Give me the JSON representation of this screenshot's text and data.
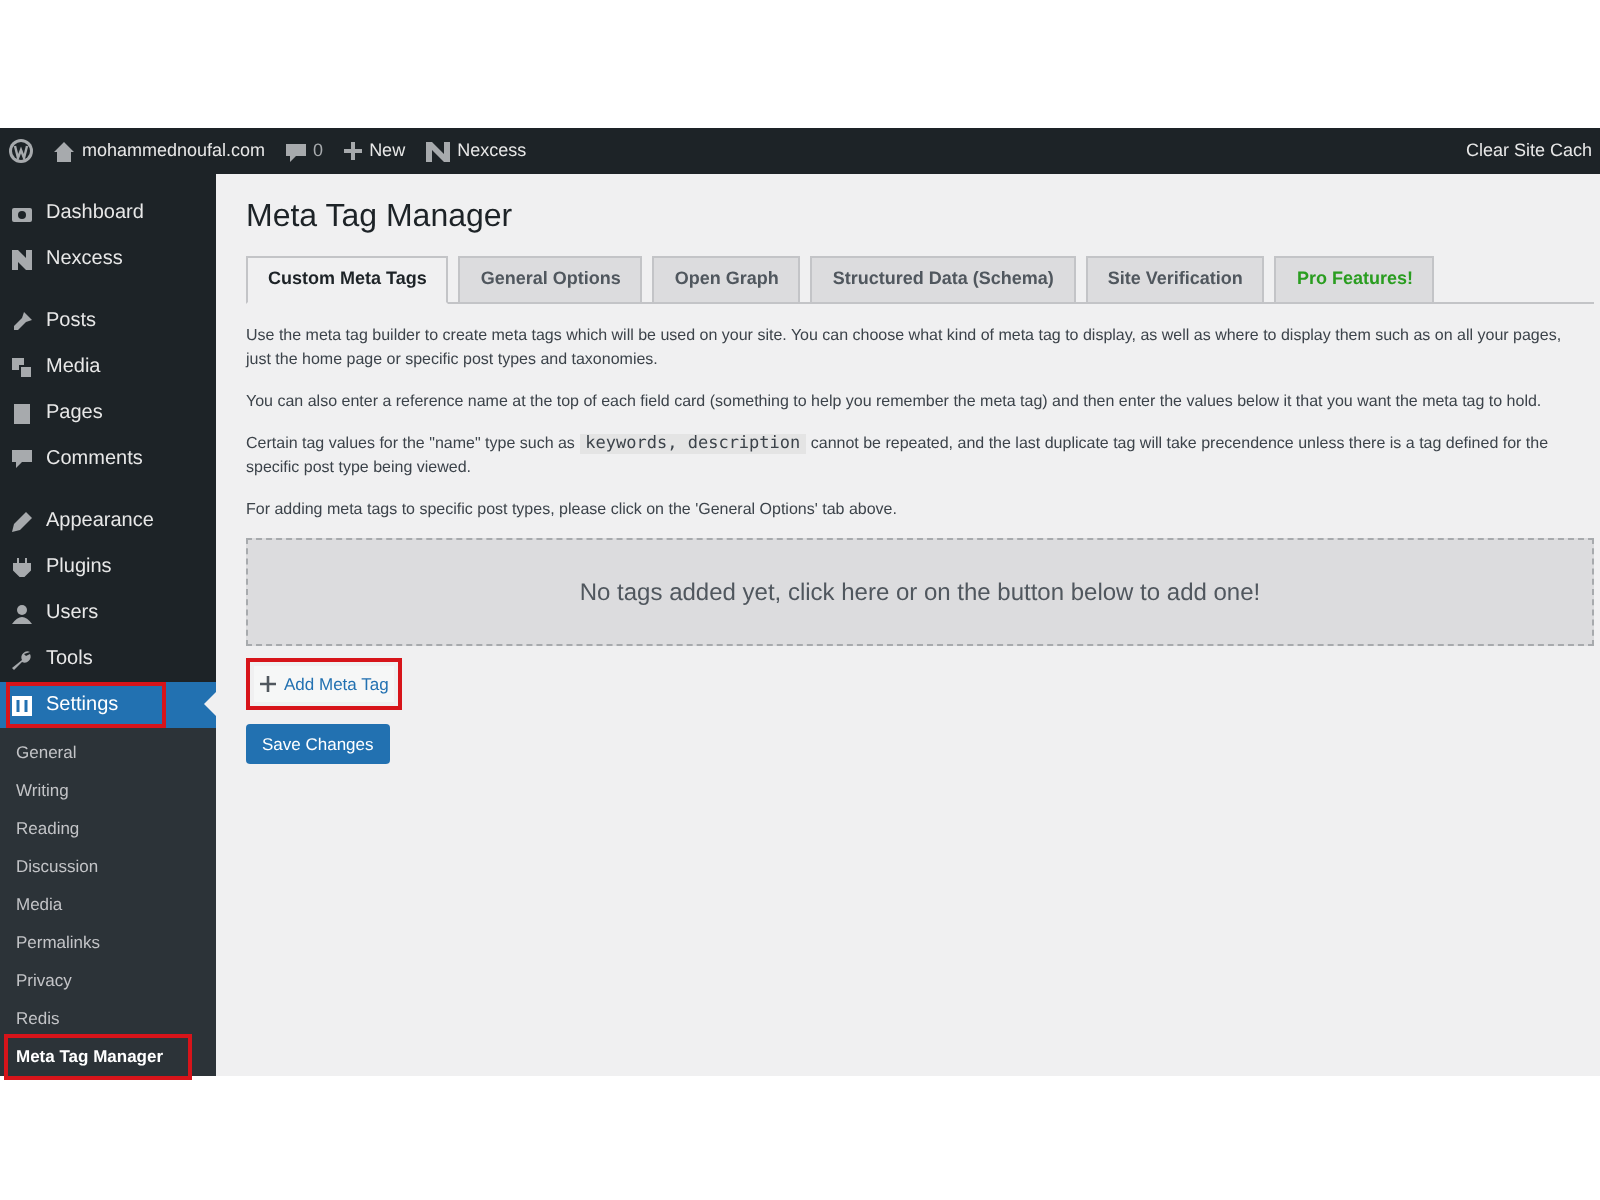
{
  "admin_bar": {
    "site_name": "mohammednoufal.com",
    "comments_count": "0",
    "new_label": "New",
    "nexcess_label": "Nexcess",
    "right_link": "Clear Site Cach"
  },
  "sidebar": {
    "menu_groups": [
      [
        {
          "label": "Dashboard",
          "selected": false,
          "highlighted": false
        },
        {
          "label": "Nexcess",
          "selected": false,
          "highlighted": false
        }
      ],
      [
        {
          "label": "Posts",
          "selected": false,
          "highlighted": false
        },
        {
          "label": "Media",
          "selected": false,
          "highlighted": false
        },
        {
          "label": "Pages",
          "selected": false,
          "highlighted": false
        },
        {
          "label": "Comments",
          "selected": false,
          "highlighted": false
        }
      ],
      [
        {
          "label": "Appearance",
          "selected": false,
          "highlighted": false
        },
        {
          "label": "Plugins",
          "selected": false,
          "highlighted": false
        },
        {
          "label": "Users",
          "selected": false,
          "highlighted": false
        },
        {
          "label": "Tools",
          "selected": false,
          "highlighted": false
        },
        {
          "label": "Settings",
          "selected": true,
          "highlighted": true
        }
      ]
    ],
    "submenu": [
      {
        "label": "General",
        "selected": false,
        "highlighted": false
      },
      {
        "label": "Writing",
        "selected": false,
        "highlighted": false
      },
      {
        "label": "Reading",
        "selected": false,
        "highlighted": false
      },
      {
        "label": "Discussion",
        "selected": false,
        "highlighted": false
      },
      {
        "label": "Media",
        "selected": false,
        "highlighted": false
      },
      {
        "label": "Permalinks",
        "selected": false,
        "highlighted": false
      },
      {
        "label": "Privacy",
        "selected": false,
        "highlighted": false
      },
      {
        "label": "Redis",
        "selected": false,
        "highlighted": false
      },
      {
        "label": "Meta Tag Manager",
        "selected": true,
        "highlighted": true
      }
    ]
  },
  "page_title": "Meta Tag Manager",
  "tabs": [
    {
      "label": "Custom Meta Tags",
      "selected": true,
      "kind": "normal"
    },
    {
      "label": "General Options",
      "selected": false,
      "kind": "normal"
    },
    {
      "label": "Open Graph",
      "selected": false,
      "kind": "normal"
    },
    {
      "label": "Structured Data (Schema)",
      "selected": false,
      "kind": "normal"
    },
    {
      "label": "Site Verification",
      "selected": false,
      "kind": "normal"
    },
    {
      "label": "Pro Features!",
      "selected": false,
      "kind": "promo"
    }
  ],
  "paragraphs": [
    {
      "text": "Use the meta tag builder to create meta tags which will be used on your site. You can choose what kind of meta tag to display, as well as where to display them such as on all your pages, just the home page or specific post types and taxonomies."
    },
    {
      "text": "You can also enter a reference name at the top of each field card (something to help you remember the meta tag) and then enter the values below it that you want the meta tag to hold."
    },
    {
      "text": "Certain tag values for the \"name\" type such as",
      "code": "keywords, description",
      "text_after": "cannot be repeated, and the last duplicate tag will take precendence unless there is a tag defined for the specific post type being viewed."
    },
    {
      "text": "For adding meta tags to specific post types, please click on the 'General Options' tab above."
    }
  ],
  "empty_area": {
    "text": "No tags added yet, click here or on the button below to add one!"
  },
  "add_button": {
    "label": "Add Meta Tag",
    "highlighted": true
  },
  "save_button": {
    "label": "Save Changes"
  }
}
